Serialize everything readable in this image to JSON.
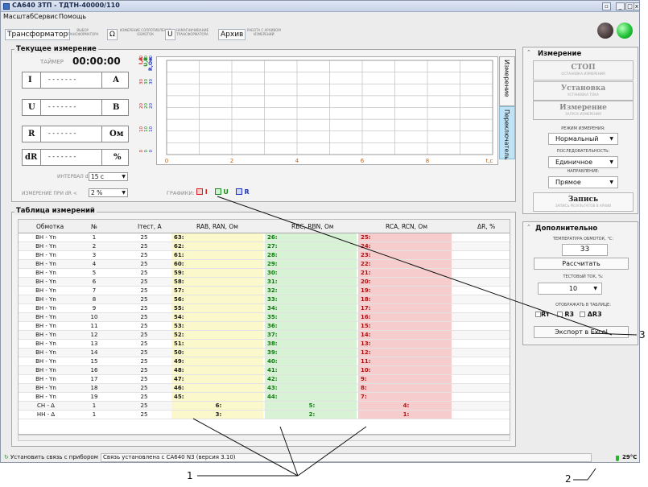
{
  "window": {
    "title": "СА640 ЗТП - ТДТН-40000/110",
    "min": "_",
    "max": "□",
    "close": "x"
  },
  "menu": [
    "Масштаб",
    "Сервис",
    "Помощь"
  ],
  "tabs": [
    {
      "label": "Трансформатор",
      "sub": [
        "ВЫБОР",
        "ТРАНСФОРМАТОРА"
      ]
    },
    {
      "label": "Ω",
      "sub": [
        "ИЗМЕРЕНИЕ СОПРОТИВЛЕНИЯ",
        "ОБМОТОК"
      ]
    },
    {
      "label": "U",
      "sub": [
        "НАМАГНИЧИВАНИЕ",
        "ТРАНСФОРМАТОРА"
      ]
    },
    {
      "label": "Архив",
      "sub": [
        "РАБОТА С АРХИВОМ",
        "ИЗМЕРЕНИЙ"
      ]
    }
  ],
  "status_lights": {
    "left": "#4a3d3d",
    "right": "#22c43a"
  },
  "current": {
    "title": "Текущее измерение",
    "timer_label": "ТАЙМЕР",
    "timer": "00:00:00",
    "rows": [
      {
        "symbol": "I",
        "value": "- - - - - - -",
        "unit": "А"
      },
      {
        "symbol": "U",
        "value": "- - - - - - -",
        "unit": "В"
      },
      {
        "symbol": "R",
        "value": "- - - - - - -",
        "unit": "Ом"
      },
      {
        "symbol": "dR",
        "value": "- - - - - - -",
        "unit": "%"
      }
    ],
    "interval_label": "ИНТЕРВАЛ dR",
    "interval_value": "15 с",
    "measure_label": "ИЗМЕРЕНИЕ ПРИ dR <",
    "measure_value": "2 %"
  },
  "chart_data": {
    "type": "line",
    "title": "",
    "axis_headers": [
      "I,A",
      "U,B",
      "R,Ом"
    ],
    "yticks": {
      "I,A": [
        "0",
        "10",
        "20",
        "30",
        "40"
      ],
      "U,B": [
        "0",
        "10",
        "20",
        "30",
        "40"
      ],
      "R,Ом": [
        "0",
        "10",
        "20",
        "30",
        "40"
      ]
    },
    "xticks": [
      "0",
      "2",
      "4",
      "6",
      "8"
    ],
    "x_unit": "t,c",
    "xlim": [
      0,
      10
    ],
    "ylim": [
      0,
      40
    ],
    "series": [],
    "legend_label": "ГРАФИКИ:",
    "legend": [
      {
        "label": "I",
        "color": "#d02020"
      },
      {
        "label": "U",
        "color": "#1a8a1a"
      },
      {
        "label": "R",
        "color": "#2030c0"
      }
    ],
    "grid": true
  },
  "sidetabs": [
    "Измерение",
    "Переключатель"
  ],
  "measurement_panel": {
    "title": "Измерение",
    "buttons": [
      {
        "label": "СТОП",
        "sub": "ОСТАНОВКА ИЗМЕРЕНИЯ"
      },
      {
        "label": "Установка",
        "sub": "УСТАНОВКА ТОКА"
      },
      {
        "label": "Измерение",
        "sub": "ЗАПУСК ИЗМЕРЕНИЯ"
      }
    ],
    "mode_label": "РЕЖИМ ИЗМЕРЕНИЯ:",
    "mode_value": "Нормальный",
    "sequence_label": "ПОСЛЕДОВАТЕЛЬНОСТЬ:",
    "sequence_value": "Единичное",
    "direction_label": "НАПРАВЛЕНИЕ:",
    "direction_value": "Прямое",
    "record_label": "Запись",
    "record_sub": "ЗАПИСЬ РЕЗУЛЬТАТОВ В АРХИВ"
  },
  "extra_panel": {
    "title": "Дополнительно",
    "temp_label": "ТЕМПЕРАТУРА ОБМОТОК, °С:",
    "temp_value": "33",
    "calc_label": "Рассчитать",
    "testcur_label": "ТЕСТОВЫЙ ТОК, %:",
    "testcur_value": "10",
    "show_label": "ОТОБРАЖАТЬ В ТАБЛИЦЕ:",
    "checks": [
      "Rт",
      "R3",
      "ΔR3"
    ],
    "export_label": "Экспорт в Excel"
  },
  "table": {
    "title": "Таблица измерений",
    "headers": [
      "Обмотка",
      "№",
      "Iтест, А",
      "RAB, RAN, Ом",
      "RBC, RBN, Ом",
      "RCA, RCN, Ом",
      "ΔR, %"
    ],
    "rows": [
      [
        "ВН - Yn",
        "1",
        "25",
        "63:",
        "26:",
        "25:"
      ],
      [
        "ВН - Yn",
        "2",
        "25",
        "62:",
        "27:",
        "24:"
      ],
      [
        "ВН - Yn",
        "3",
        "25",
        "61:",
        "28:",
        "23:"
      ],
      [
        "ВН - Yn",
        "4",
        "25",
        "60:",
        "29:",
        "22:"
      ],
      [
        "ВН - Yn",
        "5",
        "25",
        "59:",
        "30:",
        "21:"
      ],
      [
        "ВН - Yn",
        "6",
        "25",
        "58:",
        "31:",
        "20:"
      ],
      [
        "ВН - Yn",
        "7",
        "25",
        "57:",
        "32:",
        "19:"
      ],
      [
        "ВН - Yn",
        "8",
        "25",
        "56:",
        "33:",
        "18:"
      ],
      [
        "ВН - Yn",
        "9",
        "25",
        "55:",
        "34:",
        "17:"
      ],
      [
        "ВН - Yn",
        "10",
        "25",
        "54:",
        "35:",
        "16:"
      ],
      [
        "ВН - Yn",
        "11",
        "25",
        "53:",
        "36:",
        "15:"
      ],
      [
        "ВН - Yn",
        "12",
        "25",
        "52:",
        "37:",
        "14:"
      ],
      [
        "ВН - Yn",
        "13",
        "25",
        "51:",
        "38:",
        "13:"
      ],
      [
        "ВН - Yn",
        "14",
        "25",
        "50:",
        "39:",
        "12:"
      ],
      [
        "ВН - Yn",
        "15",
        "25",
        "49:",
        "40:",
        "11:"
      ],
      [
        "ВН - Yn",
        "16",
        "25",
        "48:",
        "41:",
        "10:"
      ],
      [
        "ВН - Yn",
        "17",
        "25",
        "47:",
        "42:",
        "9:"
      ],
      [
        "ВН - Yn",
        "18",
        "25",
        "46:",
        "43:",
        "8:"
      ],
      [
        "ВН - Yn",
        "19",
        "25",
        "45:",
        "44:",
        "7:"
      ],
      [
        "СН - Δ",
        "1",
        "25",
        "6:",
        "5:",
        "4:"
      ],
      [
        "НН - Δ",
        "1",
        "25",
        "3:",
        "2:",
        "1:"
      ]
    ]
  },
  "statusbar": {
    "button": "Установить связь с прибором",
    "message": "Связь установлена с СА640 N3 (версия 3.10)",
    "temp": "29°C"
  },
  "annotations": [
    "1",
    "2",
    "3"
  ]
}
